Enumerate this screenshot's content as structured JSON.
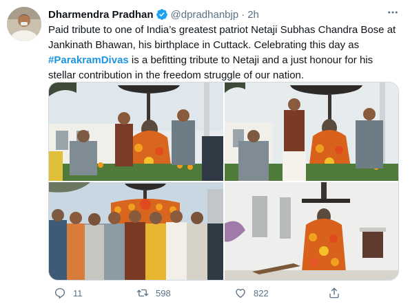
{
  "author": {
    "name": "Dharmendra Pradhan",
    "handle": "@dpradhanbjp",
    "separator": "·",
    "time": "2h",
    "verified": true
  },
  "tweet": {
    "text_before_hashtag": "Paid tribute to one of India’s greatest patriot Netaji Subhas Chandra Bose at Jankinath Bhawan, his birthplace in Cuttack. Celebrating this day as ",
    "hashtag": "#ParakramDivas",
    "text_after_hashtag": " is a befitting tribute to Netaji and a just honour for his stellar contribution in the freedom struggle of our nation."
  },
  "media": {
    "photos": [
      {
        "subject": "tribute at statue with garlands"
      },
      {
        "subject": "tribute at statue, close view"
      },
      {
        "subject": "group photo in front of statue"
      },
      {
        "subject": "garlanded statue near white building"
      }
    ]
  },
  "actions": {
    "replies": "11",
    "retweets": "598",
    "likes": "822"
  },
  "colors": {
    "accent": "#1b95e0",
    "secondary_text": "#5b7083",
    "verified_badge": "#1da1f2"
  },
  "icons": [
    "more-icon",
    "verified-icon",
    "reply-icon",
    "retweet-icon",
    "like-icon",
    "share-icon"
  ]
}
